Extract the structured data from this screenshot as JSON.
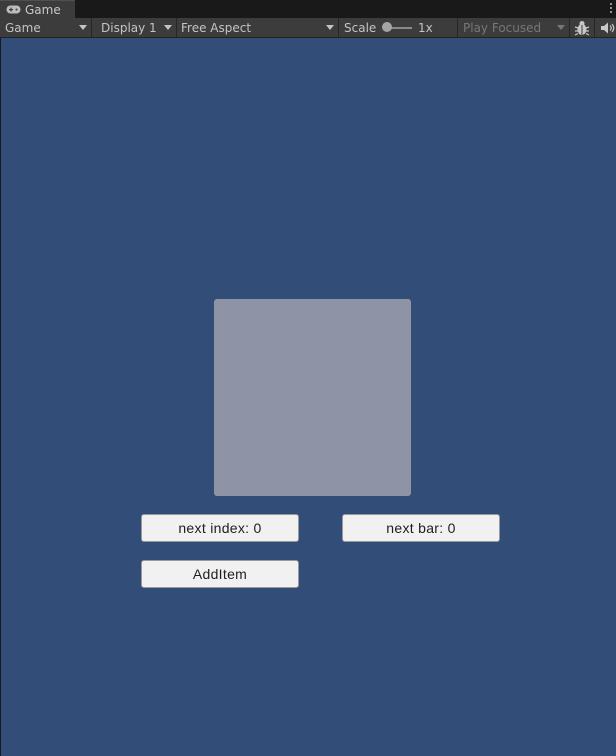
{
  "tab": {
    "label": "Game",
    "icon": "gamepad-icon"
  },
  "toolbar": {
    "view_select": "Game",
    "display_select": "Display 1",
    "aspect_select": "Free Aspect",
    "scale_label": "Scale",
    "scale_value": "1x",
    "scale_level": 0,
    "play_mode_select": "Play Focused",
    "icons": [
      "bug-icon",
      "audio-mute-icon",
      "more-options-icon"
    ]
  },
  "game": {
    "background": "#324d77",
    "square_color": "#8f93a6",
    "buttons": {
      "next_index": "next index: 0",
      "next_bar": "next bar: 0",
      "add_item": "AddItem"
    }
  }
}
